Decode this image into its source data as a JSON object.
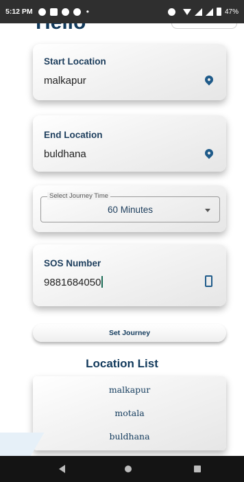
{
  "status_bar": {
    "time": "5:12 PM",
    "battery": "47%"
  },
  "header": {
    "title": "Hello",
    "top_button_label": ""
  },
  "start_location": {
    "label": "Start Location",
    "value": "malkapur",
    "icon": "location-pin-icon"
  },
  "end_location": {
    "label": "End Location",
    "value": "buldhana",
    "icon": "location-pin-icon"
  },
  "journey_time": {
    "legend": "Select Journey Time",
    "selected": "60 Minutes"
  },
  "sos": {
    "label": "SOS Number",
    "value": "9881684050",
    "icon": "phone-icon"
  },
  "set_journey_label": "Set Journey",
  "location_list": {
    "title": "Location List",
    "items": [
      "malkapur",
      "motala",
      "buldhana"
    ]
  },
  "colors": {
    "accent": "#1f5b8a",
    "text_dark": "#123a5c",
    "nav_bar": "#141414"
  }
}
